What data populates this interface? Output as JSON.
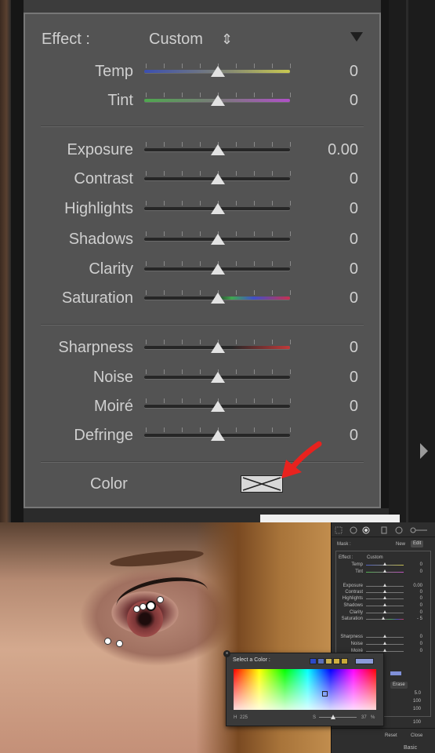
{
  "top_panel": {
    "effect_label": "Effect :",
    "effect_value": "Custom",
    "effect_stepper": "⇕",
    "collapse_icon": "triangle-down-icon",
    "color_label": "Color",
    "sliders": [
      {
        "label": "Temp",
        "value": "0",
        "track": "temp"
      },
      {
        "label": "Tint",
        "value": "0",
        "track": "tint"
      },
      {
        "label": "Exposure",
        "value": "0.00",
        "track": "plain"
      },
      {
        "label": "Contrast",
        "value": "0",
        "track": "plain"
      },
      {
        "label": "Highlights",
        "value": "0",
        "track": "plain"
      },
      {
        "label": "Shadows",
        "value": "0",
        "track": "plain"
      },
      {
        "label": "Clarity",
        "value": "0",
        "track": "plain"
      },
      {
        "label": "Saturation",
        "value": "0",
        "track": "saturation"
      },
      {
        "label": "Sharpness",
        "value": "0",
        "track": "sharpness"
      },
      {
        "label": "Noise",
        "value": "0",
        "track": "plain"
      },
      {
        "label": "Moiré",
        "value": "0",
        "track": "plain"
      },
      {
        "label": "Defringe",
        "value": "0",
        "track": "plain"
      }
    ],
    "arrow_color": "#e8221e"
  },
  "mini_panel": {
    "mask_label": "Mask :",
    "new_label": "New",
    "edit_label": "Edit",
    "effect_label": "Effect :",
    "effect_value": "Custom",
    "sliders": [
      {
        "label": "Temp",
        "value": "0"
      },
      {
        "label": "Tint",
        "value": "0"
      },
      {
        "label": "Exposure",
        "value": "0.00"
      },
      {
        "label": "Contrast",
        "value": "0"
      },
      {
        "label": "Highlights",
        "value": "0"
      },
      {
        "label": "Shadows",
        "value": "0"
      },
      {
        "label": "Clarity",
        "value": "0"
      },
      {
        "label": "Saturation",
        "value": "- 5"
      },
      {
        "label": "Sharpness",
        "value": "0"
      },
      {
        "label": "Noise",
        "value": "0"
      },
      {
        "label": "Moiré",
        "value": "0"
      }
    ],
    "erase_label": "Erase",
    "brush_values": [
      "5.0",
      "100",
      "100",
      "100"
    ],
    "reset_label": "Reset",
    "close_label": "Close",
    "basic_label": "Basic"
  },
  "color_picker": {
    "title": "Select a Color :",
    "h_label": "H",
    "h_value": "225",
    "s_label": "S",
    "s_value": "37",
    "s_unit": "%",
    "swatches": [
      "#2c49c8",
      "#5a6fb8",
      "#c8b050",
      "#d0b040",
      "#c8a838",
      "#8c9ad8"
    ]
  },
  "accent": "#e8221e"
}
